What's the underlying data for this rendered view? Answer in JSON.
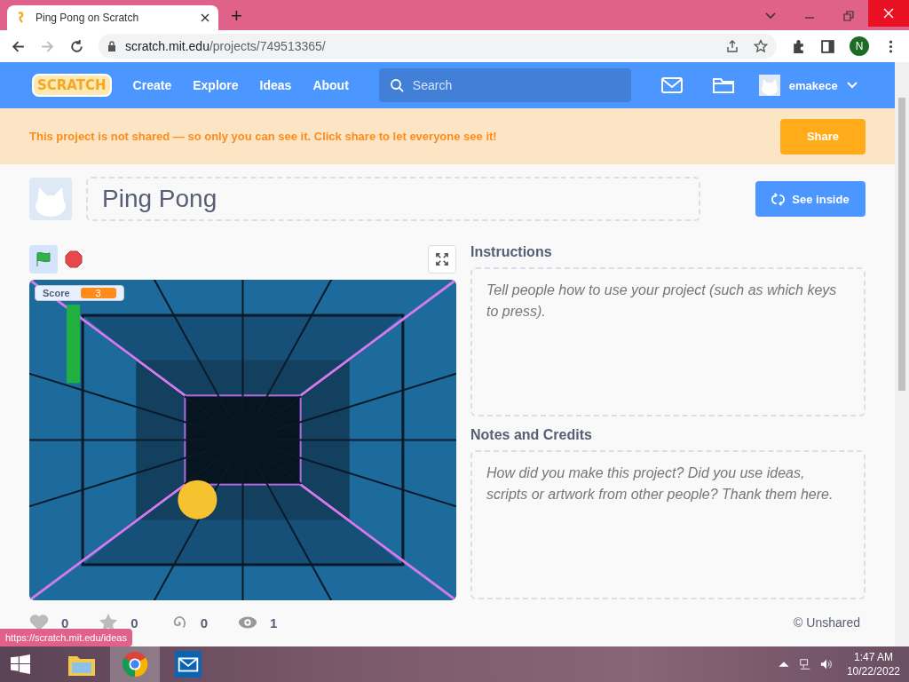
{
  "browser": {
    "tabs": [
      {
        "title": "Ping Pong on Scratch",
        "selected": true
      }
    ],
    "new_tab": "+",
    "url_host": "scratch.mit.edu",
    "url_path": "/projects/749513365/",
    "profile_initial": "N",
    "status_url": "https://scratch.mit.edu/ideas"
  },
  "nav": {
    "logo": "SCRATCH",
    "links": [
      "Create",
      "Explore",
      "Ideas",
      "About"
    ],
    "search": {
      "placeholder": "Search"
    },
    "username": "emakece"
  },
  "banner": {
    "message": "This project is not shared — so only you can see it. Click share to let everyone see it!",
    "button": "Share"
  },
  "project": {
    "title": "Ping Pong",
    "see_inside": "See inside"
  },
  "stage": {
    "monitor": {
      "label": "Score",
      "value": "3"
    }
  },
  "instructions": {
    "heading": "Instructions",
    "placeholder": "Tell people how to use your project (such as which keys to press)."
  },
  "notes": {
    "heading": "Notes and Credits",
    "placeholder": "How did you make this project? Did you use ideas, scripts or artwork from other people? Thank them here."
  },
  "stats": [
    {
      "kind": "love",
      "count": "0"
    },
    {
      "kind": "favorite",
      "count": "0"
    },
    {
      "kind": "remix",
      "count": "0"
    },
    {
      "kind": "views",
      "count": "1"
    }
  ],
  "share_status": "© Unshared",
  "taskbar": {
    "apps": [
      {
        "kind": "explorer",
        "selected": false
      },
      {
        "kind": "chrome",
        "selected": true
      },
      {
        "kind": "mail",
        "selected": false
      }
    ],
    "time": "1:47 AM",
    "date": "10/22/2022"
  }
}
